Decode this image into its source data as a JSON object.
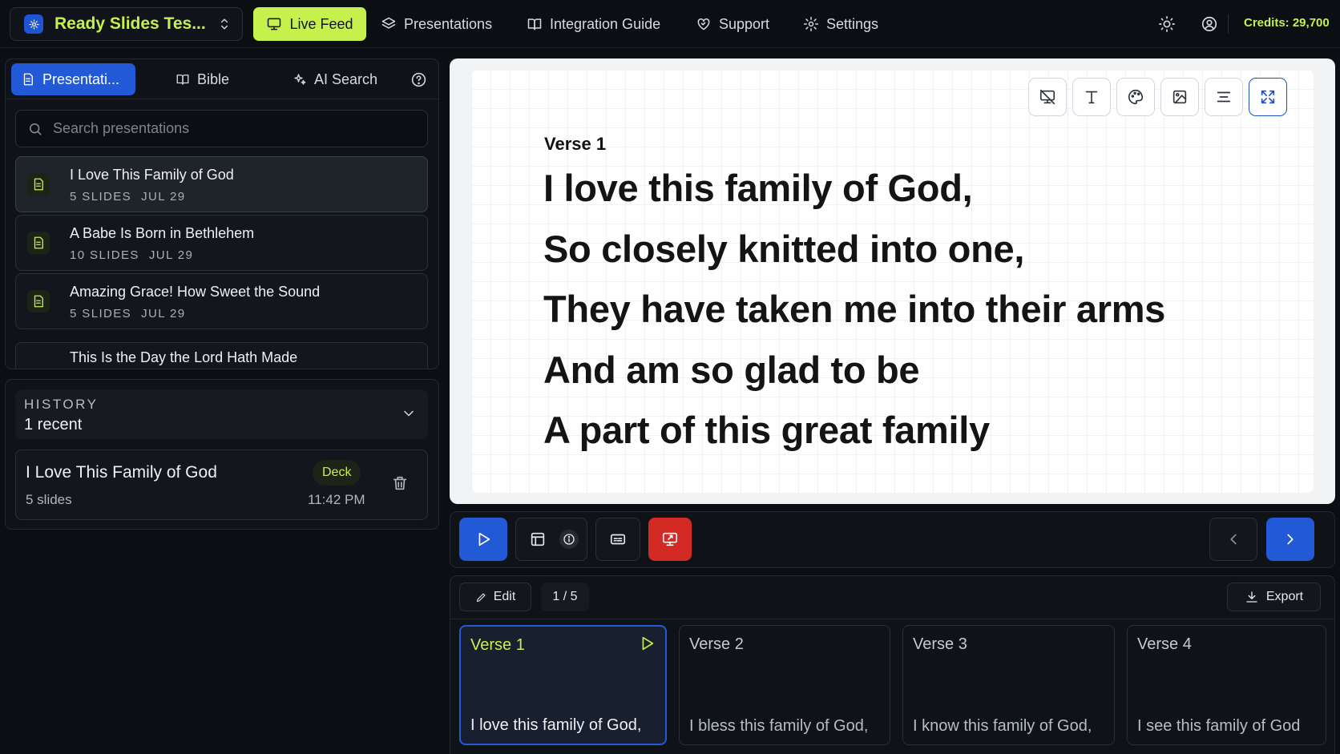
{
  "header": {
    "workspace_name": "Ready Slides Tes...",
    "nav": {
      "live_feed": "Live Feed",
      "presentations": "Presentations",
      "integration_guide": "Integration Guide",
      "support": "Support",
      "settings": "Settings"
    },
    "credits": "Credits: 29,700"
  },
  "sidebar": {
    "tabs": {
      "presentations": "Presentati...",
      "bible": "Bible",
      "ai_search": "AI Search"
    },
    "search_placeholder": "Search presentations",
    "presentations": [
      {
        "title": "I Love This Family of God",
        "slides": "5 SLIDES",
        "date": "JUL 29"
      },
      {
        "title": "A Babe Is Born in Bethlehem",
        "slides": "10 SLIDES",
        "date": "JUL 29"
      },
      {
        "title": "Amazing Grace! How Sweet the Sound",
        "slides": "5 SLIDES",
        "date": "JUL 29"
      },
      {
        "title": "This Is the Day the Lord Hath Made"
      }
    ]
  },
  "history": {
    "label": "HISTORY",
    "count": "1 recent",
    "items": [
      {
        "title": "I Love This Family of God",
        "slides": "5 slides",
        "badge": "Deck",
        "time": "11:42 PM"
      }
    ]
  },
  "preview": {
    "label": "Verse 1",
    "lines": [
      "I love this family of God,",
      "So closely knitted into one,",
      "They have taken me into their arms",
      "And am so glad to be",
      "A part of this great family"
    ]
  },
  "strip": {
    "edit_label": "Edit",
    "page_indicator": "1 / 5",
    "export_label": "Export",
    "slides": [
      {
        "title": "Verse 1",
        "text": "I love this family of God,"
      },
      {
        "title": "Verse 2",
        "text": "I bless this family of God,"
      },
      {
        "title": "Verse 3",
        "text": "I know this family of God,"
      },
      {
        "title": "Verse 4",
        "text": "I see this family of God"
      }
    ]
  },
  "colors": {
    "accent_lime": "#c6f04b",
    "accent_blue": "#2259d6",
    "danger_red": "#d32a23",
    "background": "#0b0e13"
  }
}
